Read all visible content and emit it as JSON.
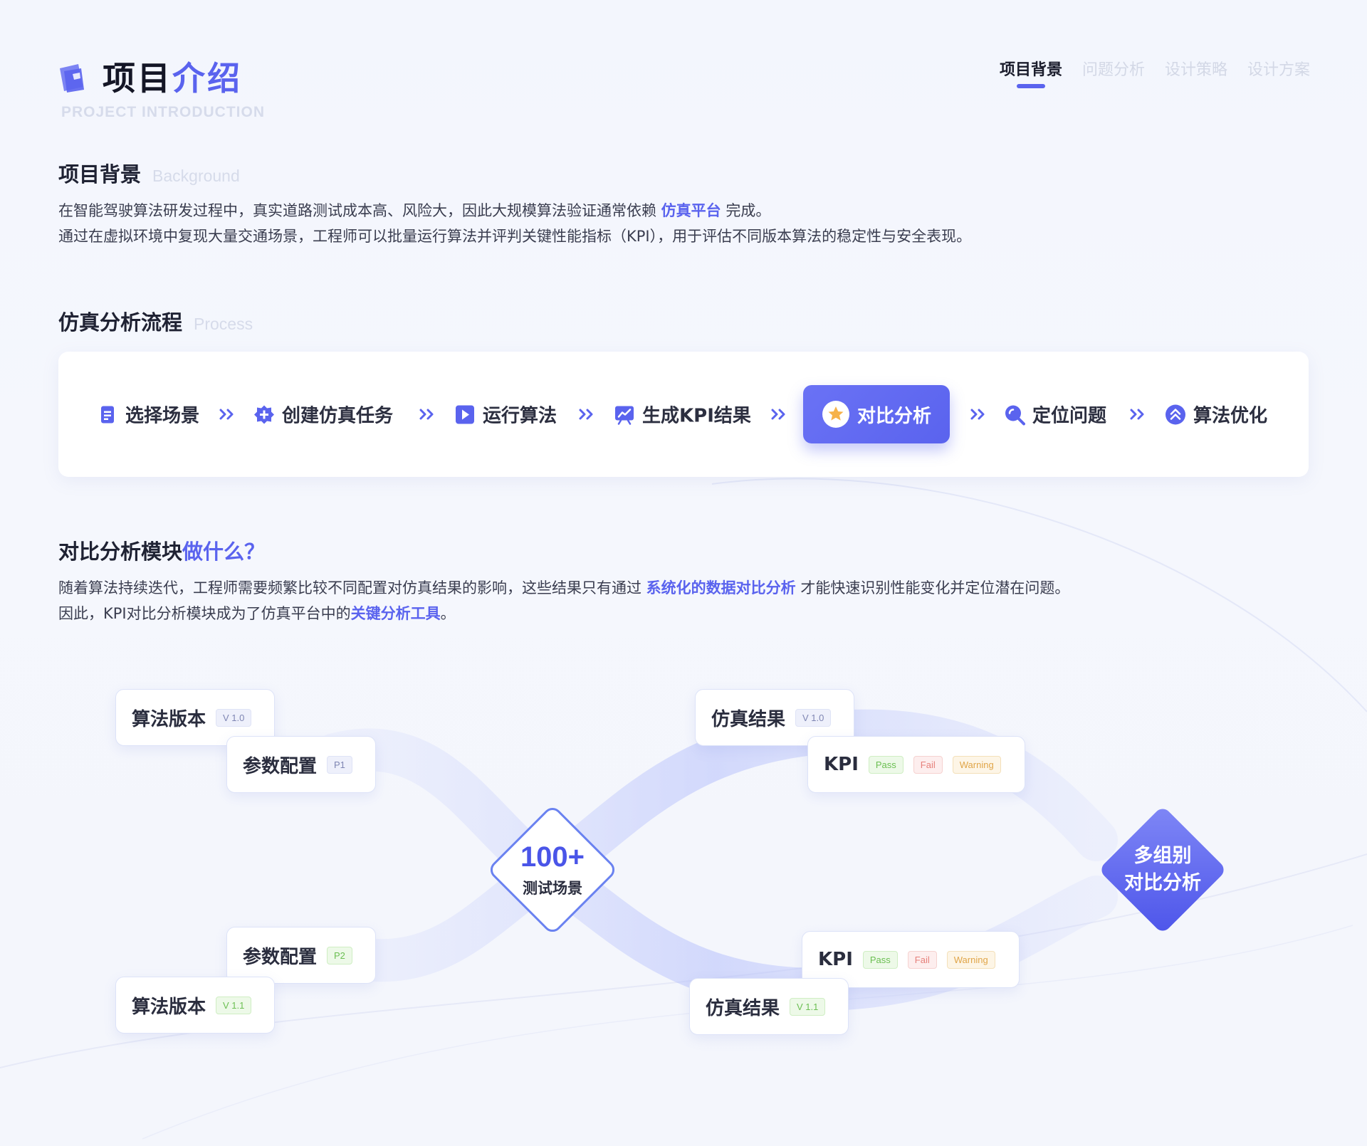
{
  "header": {
    "title_main": "项目",
    "title_accent": "介绍",
    "subtitle": "PROJECT INTRODUCTION",
    "tabs": [
      {
        "label": "项目背景",
        "active": true
      },
      {
        "label": "问题分析",
        "active": false
      },
      {
        "label": "设计策略",
        "active": false
      },
      {
        "label": "设计方案",
        "active": false
      }
    ]
  },
  "background": {
    "heading": "项目背景",
    "heading_en": "Background",
    "line1_pre": "在智能驾驶算法研发过程中，真实道路测试成本高、风险大，因此大规模算法验证通常依赖 ",
    "line1_hl": "仿真平台",
    "line1_post": " 完成。",
    "line2": "通过在虚拟环境中复现大量交通场景，工程师可以批量运行算法并评判关键性能指标（KPI），用于评估不同版本算法的稳定性与安全表现。"
  },
  "process": {
    "heading": "仿真分析流程",
    "heading_en": "Process",
    "steps": [
      {
        "label": "选择场景",
        "icon": "document-icon"
      },
      {
        "label": "创建仿真任务",
        "icon": "add-badge-icon"
      },
      {
        "label": "运行算法",
        "icon": "play-icon"
      },
      {
        "label": "生成KPI结果",
        "icon": "chart-icon"
      },
      {
        "label": "对比分析",
        "icon": "star-icon",
        "active": true
      },
      {
        "label": "定位问题",
        "icon": "search-icon"
      },
      {
        "label": "算法优化",
        "icon": "double-up-icon"
      }
    ]
  },
  "compare": {
    "heading": "对比分析模块",
    "heading_accent": "做什么？",
    "line1_pre": "随着算法持续迭代，工程师需要频繁比较不同配置对仿真结果的影响，这些结果只有通过 ",
    "line1_hl": "系统化的数据对比分析",
    "line1_post": " 才能快速识别性能变化并定位潜在问题。",
    "line2_pre": "因此，KPI对比分析模块成为了仿真平台中的",
    "line2_hl": "关键分析工具",
    "line2_post": "。"
  },
  "diagram": {
    "top_algo": {
      "label": "算法版本",
      "tag": "V 1.0"
    },
    "top_param": {
      "label": "参数配置",
      "tag": "P1"
    },
    "bottom_param": {
      "label": "参数配置",
      "tag": "P2"
    },
    "bottom_algo": {
      "label": "算法版本",
      "tag": "V 1.1"
    },
    "center": {
      "number": "100+",
      "label": "测试场景"
    },
    "top_result": {
      "label": "仿真结果",
      "tag": "V 1.0"
    },
    "top_kpi": {
      "label": "KPI",
      "pass": "Pass",
      "fail": "Fail",
      "warning": "Warning"
    },
    "bottom_kpi": {
      "label": "KPI",
      "pass": "Pass",
      "fail": "Fail",
      "warning": "Warning"
    },
    "bottom_result": {
      "label": "仿真结果",
      "tag": "V 1.1"
    },
    "end": {
      "line1": "多组别",
      "line2": "对比分析"
    }
  },
  "colors": {
    "accent": "#5a63ee",
    "pass": "#6bbf52",
    "fail": "#e6807b",
    "warning": "#e0a548"
  }
}
